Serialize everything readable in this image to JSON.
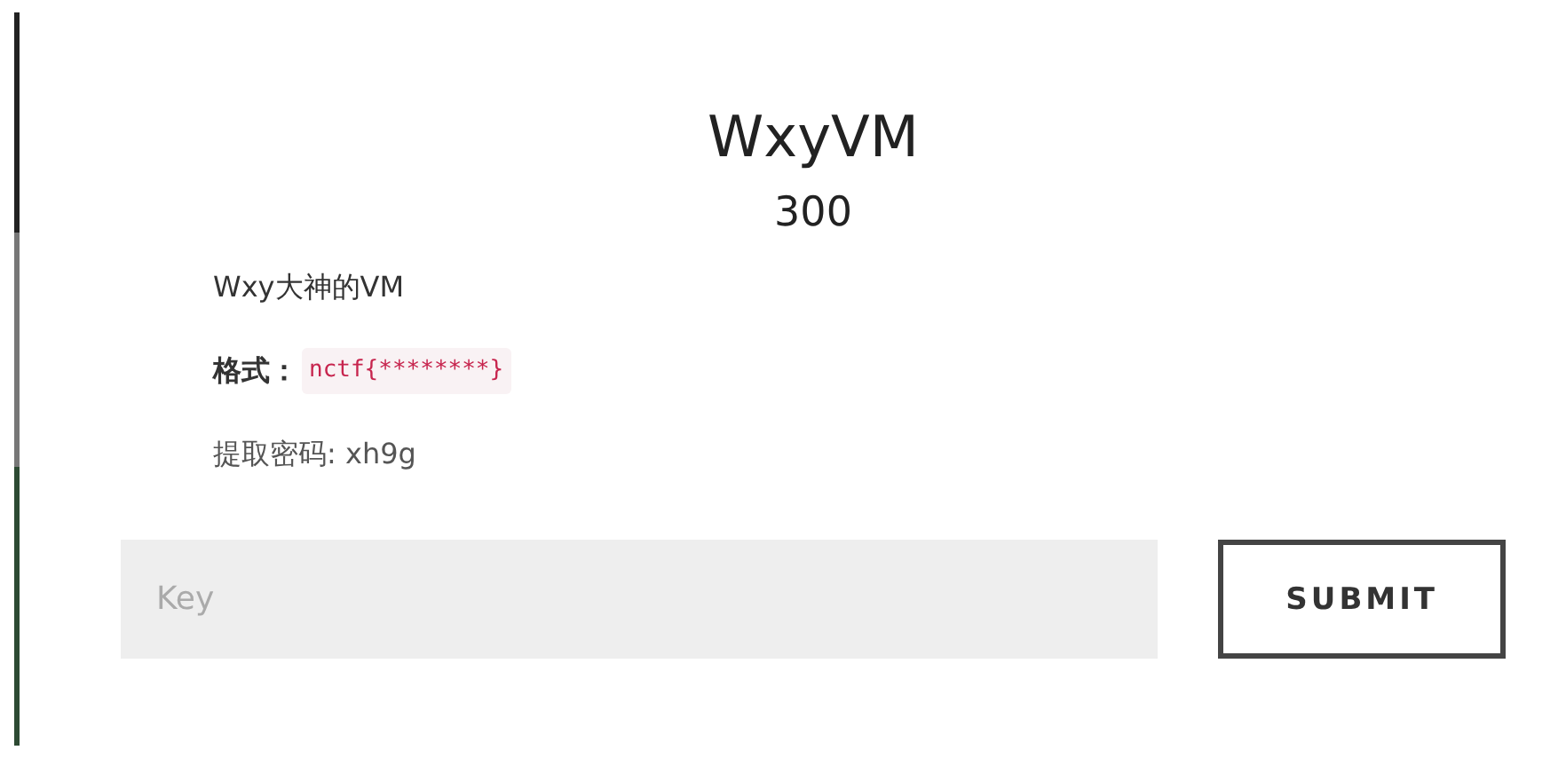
{
  "challenge": {
    "title": "WxyVM",
    "points": "300"
  },
  "description": [
    {
      "kind": "text",
      "text": "Wxy大神的VM"
    },
    {
      "kind": "format",
      "label": "格式：",
      "code": "nctf{********}"
    },
    {
      "kind": "text",
      "text": "提取密码: xh9g"
    }
  ],
  "form": {
    "placeholder": "Key",
    "button": "SUBMIT"
  }
}
